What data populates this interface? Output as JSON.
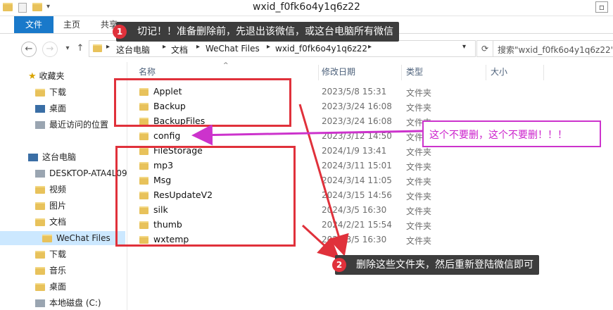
{
  "window": {
    "title": "wxid_f0fk6o4y1q6z22"
  },
  "ribbon": {
    "tabs": [
      "文件",
      "主页",
      "共享"
    ]
  },
  "address": {
    "crumbs": [
      "这台电脑",
      "文档",
      "WeChat Files",
      "wxid_f0fk6o4y1q6z22"
    ],
    "search_placeholder": "搜索\"wxid_f0fk6o4y1q6z22\""
  },
  "navpane": {
    "items": [
      {
        "label": "收藏夹",
        "icon": "star-icon"
      },
      {
        "label": "下载",
        "icon": "folder-icon"
      },
      {
        "label": "桌面",
        "icon": "desktop-icon"
      },
      {
        "label": "最近访问的位置",
        "icon": "recent-places-icon"
      },
      {
        "label": "这台电脑",
        "icon": "computer-icon"
      },
      {
        "label": "DESKTOP-ATA4L09",
        "icon": "computer-icon"
      },
      {
        "label": "视频",
        "icon": "folder-icon"
      },
      {
        "label": "图片",
        "icon": "folder-icon"
      },
      {
        "label": "文档",
        "icon": "folder-icon"
      },
      {
        "label": "WeChat Files",
        "icon": "folder-icon"
      },
      {
        "label": "下载",
        "icon": "folder-icon"
      },
      {
        "label": "音乐",
        "icon": "folder-icon"
      },
      {
        "label": "桌面",
        "icon": "folder-icon"
      },
      {
        "label": "本地磁盘 (C:)",
        "icon": "drive-icon"
      }
    ]
  },
  "filelist": {
    "columns": [
      "名称",
      "修改日期",
      "类型",
      "大小"
    ],
    "rows": [
      {
        "name": "Applet",
        "date": "2023/5/8 15:31",
        "type": "文件夹"
      },
      {
        "name": "Backup",
        "date": "2023/3/24 16:08",
        "type": "文件夹"
      },
      {
        "name": "BackupFiles",
        "date": "2023/3/24 16:08",
        "type": "文件夹"
      },
      {
        "name": "config",
        "date": "2023/3/12 14:50",
        "type": "文件夹"
      },
      {
        "name": "FileStorage",
        "date": "2024/1/9 13:41",
        "type": "文件夹"
      },
      {
        "name": "mp3",
        "date": "2024/3/11 15:01",
        "type": "文件夹"
      },
      {
        "name": "Msg",
        "date": "2024/3/14 11:05",
        "type": "文件夹"
      },
      {
        "name": "ResUpdateV2",
        "date": "2024/3/15 14:56",
        "type": "文件夹"
      },
      {
        "name": "silk",
        "date": "2024/3/5 16:30",
        "type": "文件夹"
      },
      {
        "name": "thumb",
        "date": "2024/2/21 15:54",
        "type": "文件夹"
      },
      {
        "name": "wxtemp",
        "date": "2024/3/5 16:30",
        "type": "文件夹"
      }
    ]
  },
  "annotations": {
    "callout1_num": "1",
    "callout1_text": "切记！！准备删除前，先退出该微信，或这台电脑所有微信",
    "callout2_num": "2",
    "callout2_text": "删除这些文件夹，然后重新登陆微信即可",
    "note": "这个不要删，这个不要删！！！",
    "red": "#e0313b",
    "pink": "#cc33cc"
  }
}
